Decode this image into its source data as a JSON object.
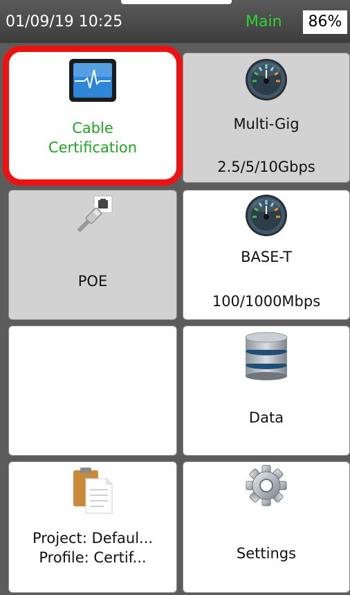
{
  "status": {
    "datetime": "01/09/19 10:25",
    "mode": "Main",
    "battery": "86%"
  },
  "tiles": {
    "cable_cert": {
      "line1": "Cable",
      "line2": "Certification",
      "icon": "waveform-monitor-icon"
    },
    "multigig": {
      "title": "Multi-Gig",
      "subtitle": "2.5/5/10Gbps",
      "icon": "gauge-icon"
    },
    "poe": {
      "title": "POE",
      "icon": "ethernet-plug-icon"
    },
    "baset": {
      "title": "BASE-T",
      "subtitle": "100/1000Mbps",
      "icon": "gauge-icon"
    },
    "empty": {},
    "data": {
      "title": "Data",
      "icon": "database-icon"
    },
    "project": {
      "line1": "Project: Defaul...",
      "line2": "Profile: Certif...",
      "icon": "clipboard-document-icon"
    },
    "settings": {
      "title": "Settings",
      "icon": "gear-icon"
    }
  },
  "colors": {
    "selected_border": "#ee1111",
    "mode_text": "#2bd633",
    "cable_cert_text": "#1fa51f"
  }
}
